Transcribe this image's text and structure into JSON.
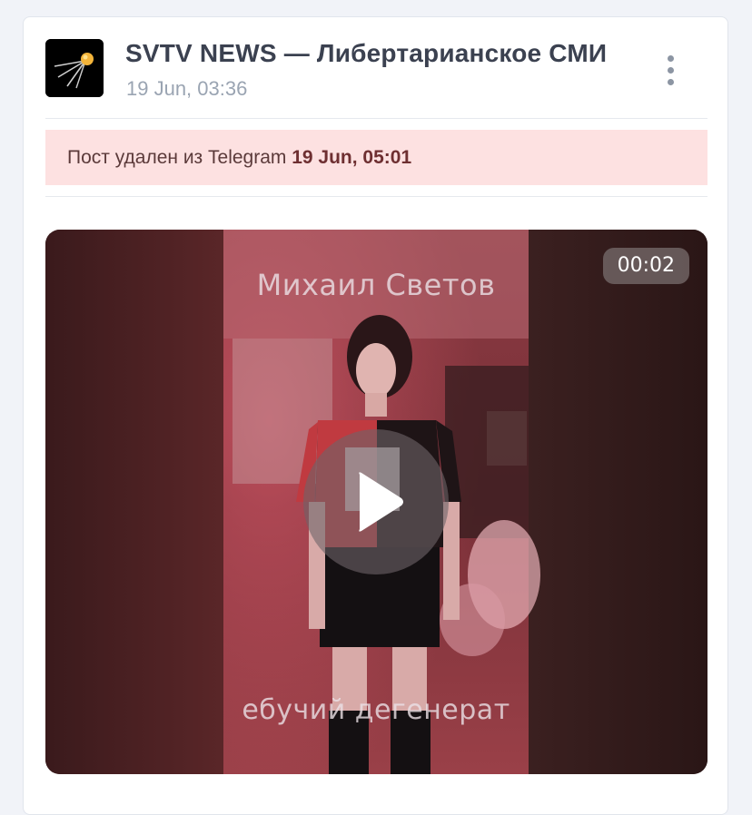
{
  "post": {
    "channel_name": "SVTV NEWS — Либертарианское СМИ",
    "date": "19 Jun, 03:36",
    "avatar_icon": "sputnik-icon",
    "menu_icon": "more-vertical-icon"
  },
  "deleted_notice": {
    "text": "Пост удален из Telegram",
    "date": "19 Jun, 05:01",
    "background": "#fde1e1"
  },
  "video": {
    "duration": "00:02",
    "caption_top": "Михаил Светов",
    "caption_bottom": "ебучий дегенерат",
    "play_icon": "play-icon"
  }
}
